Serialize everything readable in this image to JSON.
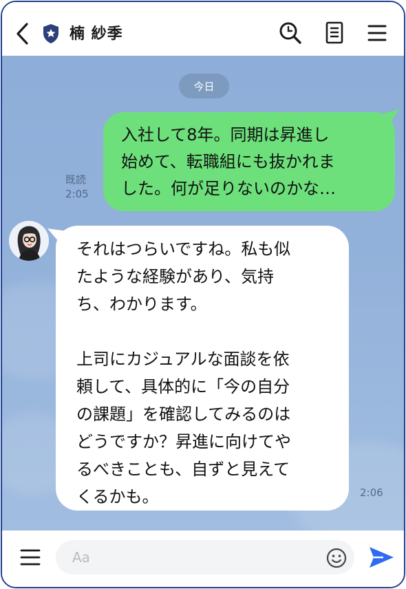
{
  "header": {
    "title": "楠 紗季",
    "icons": [
      "back-arrow-icon",
      "shield-star-icon",
      "search-icon",
      "notes-icon",
      "menu-icon"
    ]
  },
  "chat": {
    "date_label": "今日",
    "outgoing": {
      "text": "入社して8年。同期は昇進し\n始めて、転職組にも抜かれま\nした。何が足りないのかな…",
      "read_label": "既読",
      "time": "2:05"
    },
    "incoming": {
      "text": "それはつらいですね。私も似\nたような経験があり、気持\nち、わかります。\n\n上司にカジュアルな面談を依\n頼して、具体的に「今の自分\nの課題」を確認してみるのは\nどうですか？昇進に向けてや\nるべきことも、自ずと見えて\nくるかも。",
      "time": "2:06"
    }
  },
  "input": {
    "placeholder": "Aa"
  },
  "colors": {
    "frame_border": "#1f3e8e",
    "chat_background": "#8eaed9",
    "outgoing_bubble": "#6de07c",
    "incoming_bubble": "#ffffff",
    "send_icon": "#2f6bf0"
  }
}
